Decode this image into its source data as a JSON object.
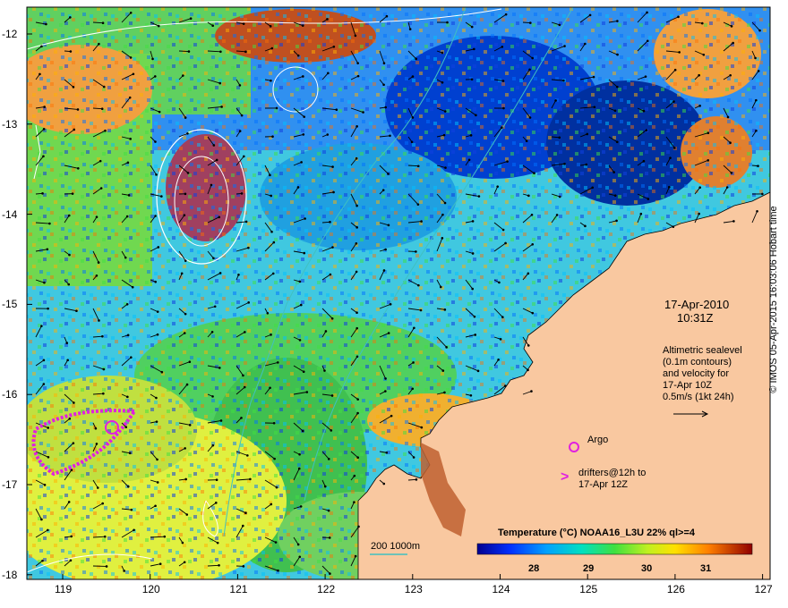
{
  "map": {
    "date": "17-Apr-2010",
    "time": "10:31Z",
    "lon_ticks": [
      "119",
      "120",
      "121",
      "122",
      "123",
      "124",
      "125",
      "126",
      "127"
    ],
    "lat_ticks": [
      "-12",
      "-13",
      "-14",
      "-15",
      "-16",
      "-17",
      "-18"
    ],
    "altimetry_lines": [
      "Altimetric sealevel",
      "(0.1m contours)",
      "and velocity for",
      "17-Apr 10Z",
      "0.5m/s (1kt 24h)"
    ],
    "argo_label": "Argo",
    "drifter_lines": [
      "drifters@12h to",
      "17-Apr 12Z"
    ],
    "depth_label": "200  1000m",
    "colorbar_title": "Temperature (°C) NOAA16_L3U 22% ql>=4",
    "colorbar_ticks": [
      "28",
      "29",
      "30",
      "31"
    ],
    "credit": "© IMOS 05-Apr-2015 16:03:06 Hobart time",
    "colors": {
      "land": "#f9c8a0",
      "argo": "#e020e0",
      "drifter": "#e020e0",
      "depth_contour": "#40c0c0"
    }
  }
}
